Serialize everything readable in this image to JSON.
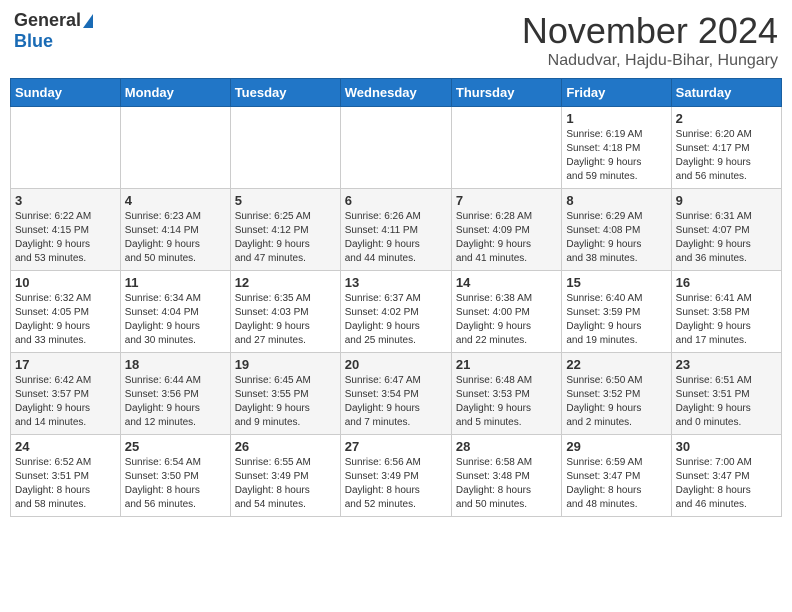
{
  "logo": {
    "general": "General",
    "blue": "Blue"
  },
  "title": "November 2024",
  "location": "Nadudvar, Hajdu-Bihar, Hungary",
  "days_of_week": [
    "Sunday",
    "Monday",
    "Tuesday",
    "Wednesday",
    "Thursday",
    "Friday",
    "Saturday"
  ],
  "weeks": [
    [
      {
        "day": "",
        "info": ""
      },
      {
        "day": "",
        "info": ""
      },
      {
        "day": "",
        "info": ""
      },
      {
        "day": "",
        "info": ""
      },
      {
        "day": "",
        "info": ""
      },
      {
        "day": "1",
        "info": "Sunrise: 6:19 AM\nSunset: 4:18 PM\nDaylight: 9 hours\nand 59 minutes."
      },
      {
        "day": "2",
        "info": "Sunrise: 6:20 AM\nSunset: 4:17 PM\nDaylight: 9 hours\nand 56 minutes."
      }
    ],
    [
      {
        "day": "3",
        "info": "Sunrise: 6:22 AM\nSunset: 4:15 PM\nDaylight: 9 hours\nand 53 minutes."
      },
      {
        "day": "4",
        "info": "Sunrise: 6:23 AM\nSunset: 4:14 PM\nDaylight: 9 hours\nand 50 minutes."
      },
      {
        "day": "5",
        "info": "Sunrise: 6:25 AM\nSunset: 4:12 PM\nDaylight: 9 hours\nand 47 minutes."
      },
      {
        "day": "6",
        "info": "Sunrise: 6:26 AM\nSunset: 4:11 PM\nDaylight: 9 hours\nand 44 minutes."
      },
      {
        "day": "7",
        "info": "Sunrise: 6:28 AM\nSunset: 4:09 PM\nDaylight: 9 hours\nand 41 minutes."
      },
      {
        "day": "8",
        "info": "Sunrise: 6:29 AM\nSunset: 4:08 PM\nDaylight: 9 hours\nand 38 minutes."
      },
      {
        "day": "9",
        "info": "Sunrise: 6:31 AM\nSunset: 4:07 PM\nDaylight: 9 hours\nand 36 minutes."
      }
    ],
    [
      {
        "day": "10",
        "info": "Sunrise: 6:32 AM\nSunset: 4:05 PM\nDaylight: 9 hours\nand 33 minutes."
      },
      {
        "day": "11",
        "info": "Sunrise: 6:34 AM\nSunset: 4:04 PM\nDaylight: 9 hours\nand 30 minutes."
      },
      {
        "day": "12",
        "info": "Sunrise: 6:35 AM\nSunset: 4:03 PM\nDaylight: 9 hours\nand 27 minutes."
      },
      {
        "day": "13",
        "info": "Sunrise: 6:37 AM\nSunset: 4:02 PM\nDaylight: 9 hours\nand 25 minutes."
      },
      {
        "day": "14",
        "info": "Sunrise: 6:38 AM\nSunset: 4:00 PM\nDaylight: 9 hours\nand 22 minutes."
      },
      {
        "day": "15",
        "info": "Sunrise: 6:40 AM\nSunset: 3:59 PM\nDaylight: 9 hours\nand 19 minutes."
      },
      {
        "day": "16",
        "info": "Sunrise: 6:41 AM\nSunset: 3:58 PM\nDaylight: 9 hours\nand 17 minutes."
      }
    ],
    [
      {
        "day": "17",
        "info": "Sunrise: 6:42 AM\nSunset: 3:57 PM\nDaylight: 9 hours\nand 14 minutes."
      },
      {
        "day": "18",
        "info": "Sunrise: 6:44 AM\nSunset: 3:56 PM\nDaylight: 9 hours\nand 12 minutes."
      },
      {
        "day": "19",
        "info": "Sunrise: 6:45 AM\nSunset: 3:55 PM\nDaylight: 9 hours\nand 9 minutes."
      },
      {
        "day": "20",
        "info": "Sunrise: 6:47 AM\nSunset: 3:54 PM\nDaylight: 9 hours\nand 7 minutes."
      },
      {
        "day": "21",
        "info": "Sunrise: 6:48 AM\nSunset: 3:53 PM\nDaylight: 9 hours\nand 5 minutes."
      },
      {
        "day": "22",
        "info": "Sunrise: 6:50 AM\nSunset: 3:52 PM\nDaylight: 9 hours\nand 2 minutes."
      },
      {
        "day": "23",
        "info": "Sunrise: 6:51 AM\nSunset: 3:51 PM\nDaylight: 9 hours\nand 0 minutes."
      }
    ],
    [
      {
        "day": "24",
        "info": "Sunrise: 6:52 AM\nSunset: 3:51 PM\nDaylight: 8 hours\nand 58 minutes."
      },
      {
        "day": "25",
        "info": "Sunrise: 6:54 AM\nSunset: 3:50 PM\nDaylight: 8 hours\nand 56 minutes."
      },
      {
        "day": "26",
        "info": "Sunrise: 6:55 AM\nSunset: 3:49 PM\nDaylight: 8 hours\nand 54 minutes."
      },
      {
        "day": "27",
        "info": "Sunrise: 6:56 AM\nSunset: 3:49 PM\nDaylight: 8 hours\nand 52 minutes."
      },
      {
        "day": "28",
        "info": "Sunrise: 6:58 AM\nSunset: 3:48 PM\nDaylight: 8 hours\nand 50 minutes."
      },
      {
        "day": "29",
        "info": "Sunrise: 6:59 AM\nSunset: 3:47 PM\nDaylight: 8 hours\nand 48 minutes."
      },
      {
        "day": "30",
        "info": "Sunrise: 7:00 AM\nSunset: 3:47 PM\nDaylight: 8 hours\nand 46 minutes."
      }
    ]
  ]
}
